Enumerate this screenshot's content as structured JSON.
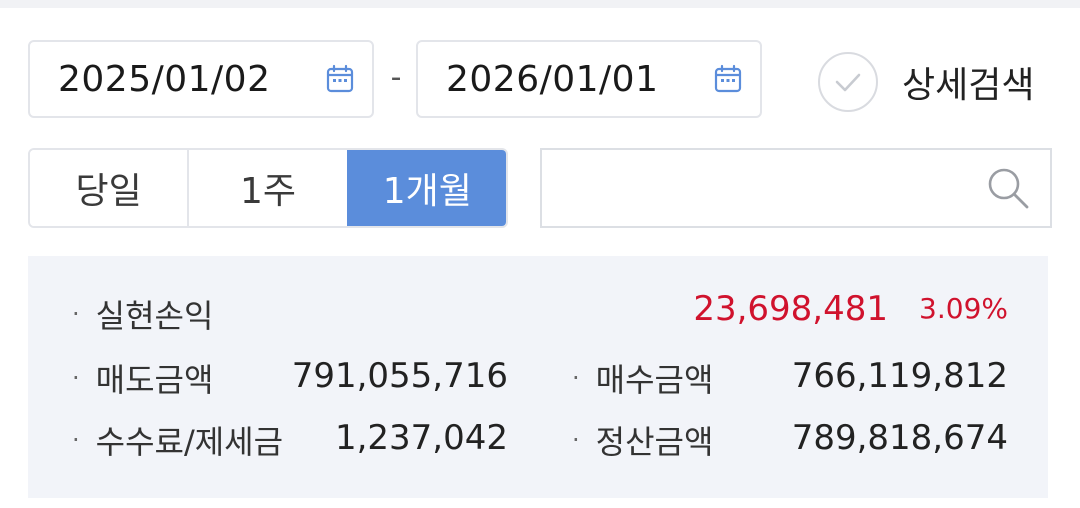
{
  "date_range": {
    "start": "2025/01/02",
    "separator": "-",
    "end": "2026/01/01"
  },
  "detail_search": {
    "label": "상세검색",
    "checked": false
  },
  "period_tabs": [
    {
      "label": "당일",
      "active": false
    },
    {
      "label": "1주",
      "active": false
    },
    {
      "label": "1개월",
      "active": true
    }
  ],
  "search": {
    "value": "",
    "placeholder": ""
  },
  "summary": {
    "realized_pnl": {
      "label": "실현손익",
      "value": "23,698,481",
      "rate": "3.09%"
    },
    "sell_amount": {
      "label": "매도금액",
      "value": "791,055,716"
    },
    "buy_amount": {
      "label": "매수금액",
      "value": "766,119,812"
    },
    "fee_tax": {
      "label": "수수료/제세금",
      "value": "1,237,042"
    },
    "settlement_amount": {
      "label": "정산금액",
      "value": "789,818,674"
    },
    "bullet": "·"
  },
  "colors": {
    "accent": "#5b8ddb",
    "profit_red": "#d0122d",
    "panel_bg": "#f2f4f9",
    "border": "#e3e5ea"
  },
  "icons": [
    "calendar-icon",
    "check-circle-icon",
    "search-icon"
  ]
}
